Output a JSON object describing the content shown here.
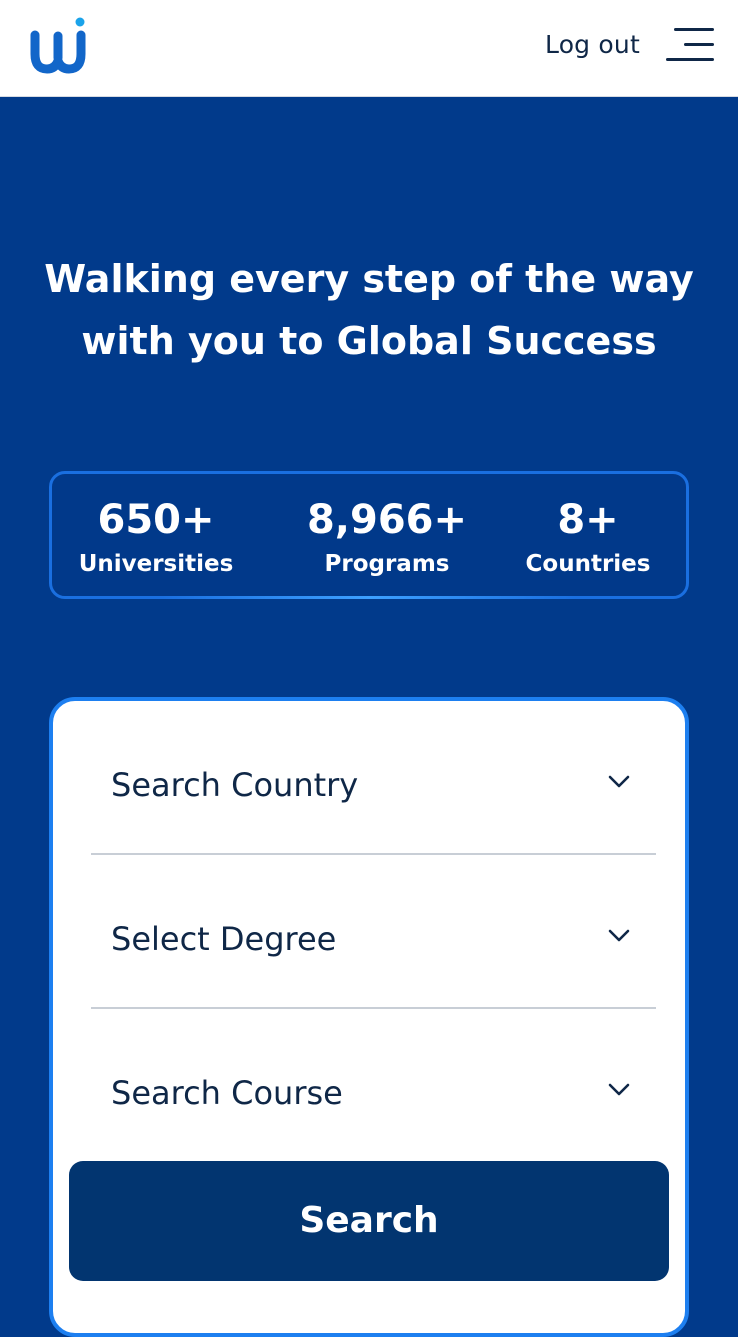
{
  "header": {
    "logo_icon": "wi-logo",
    "logout_label": "Log out",
    "menu_icon": "hamburger-menu-icon"
  },
  "hero": {
    "line1": "Walking every step of the way",
    "line2": "with you to Global Success"
  },
  "stats": [
    {
      "value": "650+",
      "label": "Universities"
    },
    {
      "value": "8,966+",
      "label": "Programs"
    },
    {
      "value": "8+",
      "label": "Countries"
    }
  ],
  "search_form": {
    "country_placeholder": "Search Country",
    "degree_placeholder": "Select Degree",
    "course_placeholder": "Search Course",
    "search_label": "Search"
  },
  "colors": {
    "background": "#013a8b",
    "accent": "#1d7ff0",
    "button": "#023570",
    "text_dark": "#0f2747"
  }
}
